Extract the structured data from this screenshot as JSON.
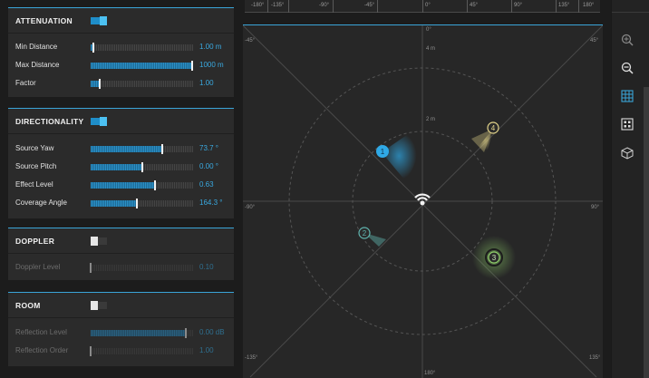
{
  "attenuation": {
    "title": "ATTENUATION",
    "rows": [
      {
        "label": "Min Distance",
        "value": "1.00 m",
        "level": 0.03
      },
      {
        "label": "Max Distance",
        "value": "1000 m",
        "level": 0.99
      },
      {
        "label": "Factor",
        "value": "1.00",
        "level": 0.09
      }
    ]
  },
  "directionality": {
    "title": "DIRECTIONALITY",
    "rows": [
      {
        "label": "Source Yaw",
        "value": "73.7 °",
        "level": 0.7
      },
      {
        "label": "Source Pitch",
        "value": "0.00 °",
        "level": 0.5
      },
      {
        "label": "Effect Level",
        "value": "0.63",
        "level": 0.63
      },
      {
        "label": "Coverage Angle",
        "value": "164.3 °",
        "level": 0.45
      }
    ]
  },
  "doppler": {
    "title": "DOPPLER",
    "rows": [
      {
        "label": "Doppler Level",
        "value": "0.10",
        "level": 0.0
      }
    ]
  },
  "room": {
    "title": "ROOM",
    "rows": [
      {
        "label": "Reflection Level",
        "value": "0.00 dB",
        "level": 0.93
      },
      {
        "label": "Reflection Order",
        "value": "1.00",
        "level": 0.0
      }
    ]
  },
  "ruler": {
    "labels": [
      "-180°",
      "-135°",
      "-90°",
      "-45°",
      "0°",
      "45°",
      "90°",
      "135°",
      "180°"
    ]
  },
  "stage": {
    "deg_top": "0°",
    "deg_bottom": "180°",
    "deg_left": "-90°",
    "deg_right": "90°",
    "deg_tl": "-45°",
    "deg_tr": "45°",
    "deg_bl": "-135°",
    "deg_br": "135°",
    "ring_outer": "4 m",
    "ring_inner": "2 m"
  },
  "sources": [
    {
      "id": "1",
      "color": "#2fa9e6"
    },
    {
      "id": "2",
      "color": "#5fb3ad"
    },
    {
      "id": "3",
      "color": "#8fcf6a"
    },
    {
      "id": "4",
      "color": "#e3d48a"
    }
  ],
  "colors": {
    "accent": "#3aa5d8",
    "panel": "#2b2b2b",
    "background": "#1c1c1c"
  },
  "toolbar": {
    "icons": [
      "zoom-in-icon",
      "zoom-out-icon",
      "grid-view-icon",
      "dots-view-icon",
      "cube-3d-icon"
    ]
  }
}
